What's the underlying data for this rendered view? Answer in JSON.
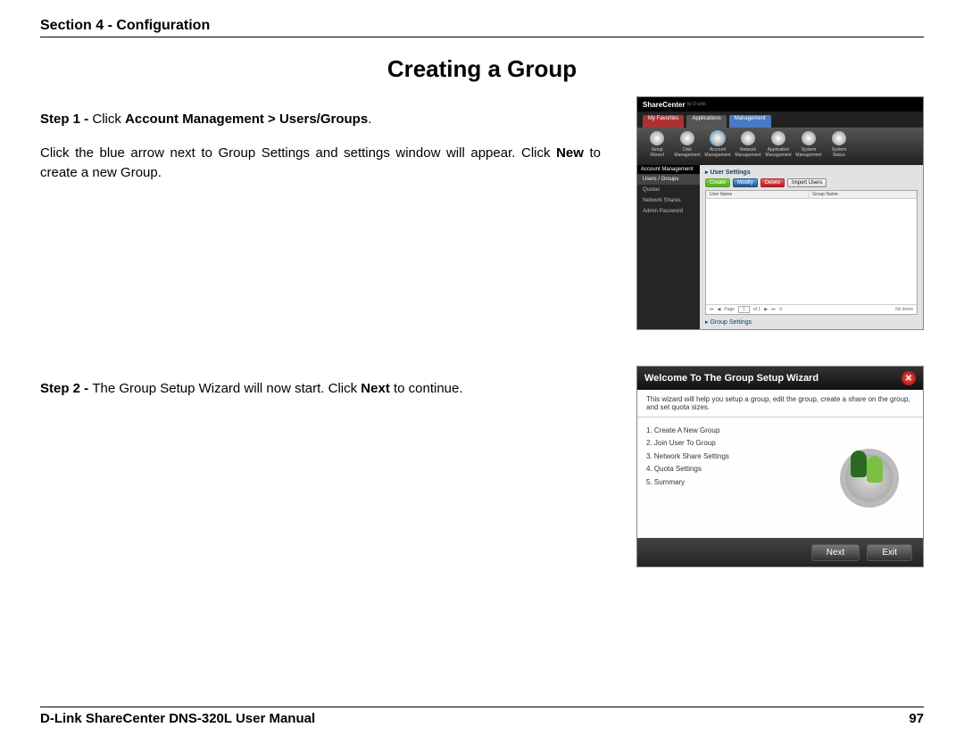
{
  "header": {
    "section": "Section 4 - Configuration"
  },
  "title": "Creating a Group",
  "step1": {
    "prefix": "Step 1 - ",
    "instruction_lead": "Click ",
    "path": "Account Management > Users/Groups",
    "period": ".",
    "body_a": "Click the blue arrow next to Group Settings and settings window will appear. Click ",
    "body_new": "New",
    "body_b": " to create a new Group."
  },
  "step2": {
    "prefix": "Step 2 - ",
    "body_a": "The Group Setup Wizard will now start. Click ",
    "body_next": "Next",
    "body_b": " to continue."
  },
  "ss1": {
    "brand": "ShareCenter",
    "brand_sub": "by D-Link",
    "tabs": {
      "favorites": "My Favorites",
      "applications": "Applications",
      "management": "Management"
    },
    "icons": {
      "setup_wizard": "Setup Wizard",
      "disk_management": "Disk Management",
      "account_management": "Account Management",
      "network_management": "Network Management",
      "application_management": "Application Management",
      "system_management": "System Management",
      "system_status": "System Status"
    },
    "sidebar_title": "Account Management",
    "sidebar": {
      "users_groups": "Users / Groups",
      "quotas": "Quotas",
      "network_shares": "Network Shares",
      "admin_password": "Admin Password"
    },
    "user_settings": "User Settings",
    "buttons": {
      "create": "Create",
      "modify": "Modify",
      "delete": "Delete",
      "import_users": "Import Users"
    },
    "grid": {
      "col1": "User Name",
      "col2": "Group Name"
    },
    "pager": {
      "page_label": "Page",
      "page_value": "1",
      "of": "of 1",
      "no_items": "No items"
    },
    "group_settings": "Group Settings"
  },
  "ss2": {
    "title": "Welcome To The Group Setup Wizard",
    "intro": "This wizard will help you setup a group, edit the group, create a share on the group, and set quota sizes.",
    "steps": {
      "s1": "1. Create A New Group",
      "s2": "2. Join User To Group",
      "s3": "3. Network Share Settings",
      "s4": "4. Quota Settings",
      "s5": "5. Summary"
    },
    "buttons": {
      "next": "Next",
      "exit": "Exit"
    }
  },
  "footer": {
    "manual": "D-Link ShareCenter DNS-320L User Manual",
    "page": "97"
  }
}
